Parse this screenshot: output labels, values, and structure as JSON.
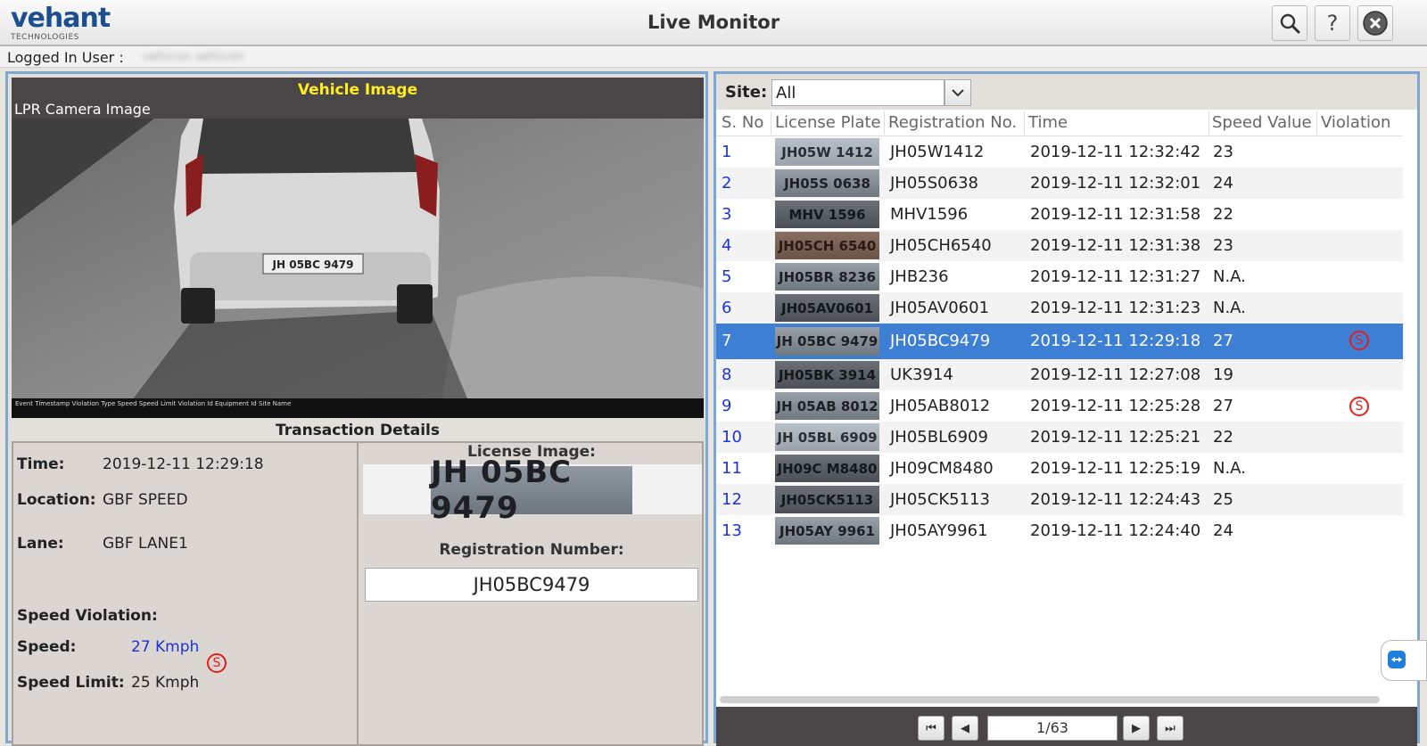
{
  "app": {
    "logo_main": "vehant",
    "logo_sub": "TECHNOLOGIES",
    "title": "Live Monitor"
  },
  "userbar": {
    "label": "Logged In User :",
    "username": "vehicon vehicon"
  },
  "vehicle_panel": {
    "title": "Vehicle Image",
    "camera_label": "LPR Camera Image",
    "camera_overlay": "Event Timestamp  Violation Type  Speed  Speed Limit  Violation Id  Equipment Id  Site Name",
    "camera_plate": "JH 05BC 9479"
  },
  "transaction": {
    "title": "Transaction Details",
    "time_label": "Time:",
    "time_value": "2019-12-11 12:29:18",
    "location_label": "Location:",
    "location_value": "GBF SPEED",
    "lane_label": "Lane:",
    "lane_value": "GBF LANE1",
    "speed_violation_label": "Speed Violation:",
    "speed_label": "Speed:",
    "speed_value": "27 Kmph",
    "speed_limit_label": "Speed Limit:",
    "speed_limit_value": "25 Kmph",
    "violation_icon": "S",
    "license_image_label": "License Image:",
    "license_image_text": "JH 05BC 9479",
    "registration_label": "Registration Number:",
    "registration_value": "JH05BC9479"
  },
  "site": {
    "label": "Site:",
    "selected": "All"
  },
  "table": {
    "columns": [
      "S. No",
      "License Plate",
      "Registration No.",
      "Time",
      "Speed Value",
      "Violation"
    ],
    "rows": [
      {
        "sno": "1",
        "plate_text": "JH05W 1412",
        "reg": "JH05W1412",
        "time": "2019-12-11 12:32:42",
        "speed": "23",
        "violation": ""
      },
      {
        "sno": "2",
        "plate_text": "JH05S 0638",
        "reg": "JH05S0638",
        "time": "2019-12-11 12:32:01",
        "speed": "24",
        "violation": ""
      },
      {
        "sno": "3",
        "plate_text": "MHV 1596",
        "reg": "MHV1596",
        "time": "2019-12-11 12:31:58",
        "speed": "22",
        "violation": ""
      },
      {
        "sno": "4",
        "plate_text": "JH05CH 6540",
        "reg": "JH05CH6540",
        "time": "2019-12-11 12:31:38",
        "speed": "23",
        "violation": ""
      },
      {
        "sno": "5",
        "plate_text": "JH05BR 8236",
        "reg": "JHB236",
        "time": "2019-12-11 12:31:27",
        "speed": "N.A.",
        "violation": ""
      },
      {
        "sno": "6",
        "plate_text": "JH05AV0601",
        "reg": "JH05AV0601",
        "time": "2019-12-11 12:31:23",
        "speed": "N.A.",
        "violation": ""
      },
      {
        "sno": "7",
        "plate_text": "JH 05BC 9479",
        "reg": "JH05BC9479",
        "time": "2019-12-11 12:29:18",
        "speed": "27",
        "violation": "S"
      },
      {
        "sno": "8",
        "plate_text": "JH05BK 3914",
        "reg": "UK3914",
        "time": "2019-12-11 12:27:08",
        "speed": "19",
        "violation": ""
      },
      {
        "sno": "9",
        "plate_text": "JH 05AB 8012",
        "reg": "JH05AB8012",
        "time": "2019-12-11 12:25:28",
        "speed": "27",
        "violation": "S"
      },
      {
        "sno": "10",
        "plate_text": "JH 05BL 6909",
        "reg": "JH05BL6909",
        "time": "2019-12-11 12:25:21",
        "speed": "22",
        "violation": ""
      },
      {
        "sno": "11",
        "plate_text": "JH09C M8480",
        "reg": "JH09CM8480",
        "time": "2019-12-11 12:25:19",
        "speed": "N.A.",
        "violation": ""
      },
      {
        "sno": "12",
        "plate_text": "JH05CK5113",
        "reg": "JH05CK5113",
        "time": "2019-12-11 12:24:43",
        "speed": "25",
        "violation": ""
      },
      {
        "sno": "13",
        "plate_text": "JH05AY 9961",
        "reg": "JH05AY9961",
        "time": "2019-12-11 12:24:40",
        "speed": "24",
        "violation": ""
      }
    ],
    "selected_index": 6
  },
  "pager": {
    "page_value": "1/63"
  },
  "colors": {
    "accent_blue": "#3d7fd4",
    "panel_border": "#7fa7d4",
    "header_dark": "#4a4546",
    "violation_red": "#e32020",
    "title_yellow": "#ffee22",
    "link_blue": "#1c33d6"
  }
}
